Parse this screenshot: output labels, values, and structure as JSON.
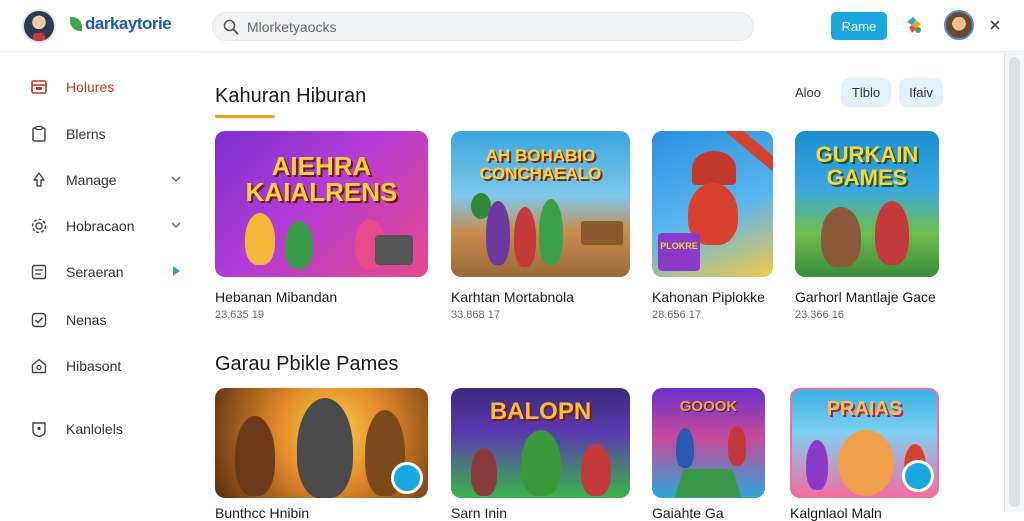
{
  "header": {
    "brand": "darkaytorie",
    "search_placeholder": "Mlorketyaocks",
    "primary_button": "Rame"
  },
  "sidebar": {
    "items": [
      {
        "label": "Holures",
        "icon": "inbox-icon",
        "active": true
      },
      {
        "label": "Blerns",
        "icon": "clipboard-icon"
      },
      {
        "label": "Manage",
        "icon": "recycle-icon",
        "chevron": "down"
      },
      {
        "label": "Hobracaon",
        "icon": "gear-icon",
        "chevron": "down"
      },
      {
        "label": "Seraeran",
        "icon": "list-icon",
        "chevron": "right"
      },
      {
        "label": "Nenas",
        "icon": "check-icon"
      },
      {
        "label": "Hibasont",
        "icon": "home-icon"
      },
      {
        "label": "Kanlolels",
        "icon": "shield-icon"
      }
    ]
  },
  "section1": {
    "title": "Kahuran Hiburan",
    "filters": [
      "Aloo",
      "Tlblo",
      "Ifaiv"
    ],
    "cards": [
      {
        "title": "Hebanan Mibandan",
        "meta": "23.635 19",
        "art": "AIEHRA KAIALRENS",
        "colors": [
          "#7b2fd0",
          "#e84a8a",
          "#f5b83a"
        ]
      },
      {
        "title": "Karhtan Mortabnola",
        "meta": "33.868 17",
        "art": "AH BOHABIO CONCHAEALO",
        "colors": [
          "#1d7cc9",
          "#f39a2d",
          "#6fbd55"
        ]
      },
      {
        "title": "Kahonan Piplokke",
        "meta": "28.656 17",
        "art": "PLOKRE",
        "colors": [
          "#2b8fe0",
          "#f0c94a",
          "#d9412f"
        ]
      },
      {
        "title": "Garhorl Mantlaje Gace",
        "meta": "23.366 16",
        "art": "GURKAIN GAMES",
        "colors": [
          "#1a9d6e",
          "#f5d23d",
          "#3a7be0"
        ]
      }
    ]
  },
  "section2": {
    "title": "Garau Pbikle Pames",
    "cards": [
      {
        "title": "Bunthcc Hnibin",
        "art": "",
        "colors": [
          "#5a2d10",
          "#e38a2a",
          "#f7d24a"
        ]
      },
      {
        "title": "Sarn Inin",
        "art": "BALOPN",
        "colors": [
          "#3c2a7a",
          "#3bb54a",
          "#f5c13a"
        ]
      },
      {
        "title": "Gaiahte Ga",
        "art": "GOOOK",
        "colors": [
          "#6a2fc9",
          "#f2a735",
          "#2ba6d8"
        ]
      },
      {
        "title": "Kalgnlaol Maln",
        "art": "PRAIAS",
        "colors": [
          "#f06fa0",
          "#fbc24a",
          "#39b0e6"
        ]
      }
    ]
  }
}
